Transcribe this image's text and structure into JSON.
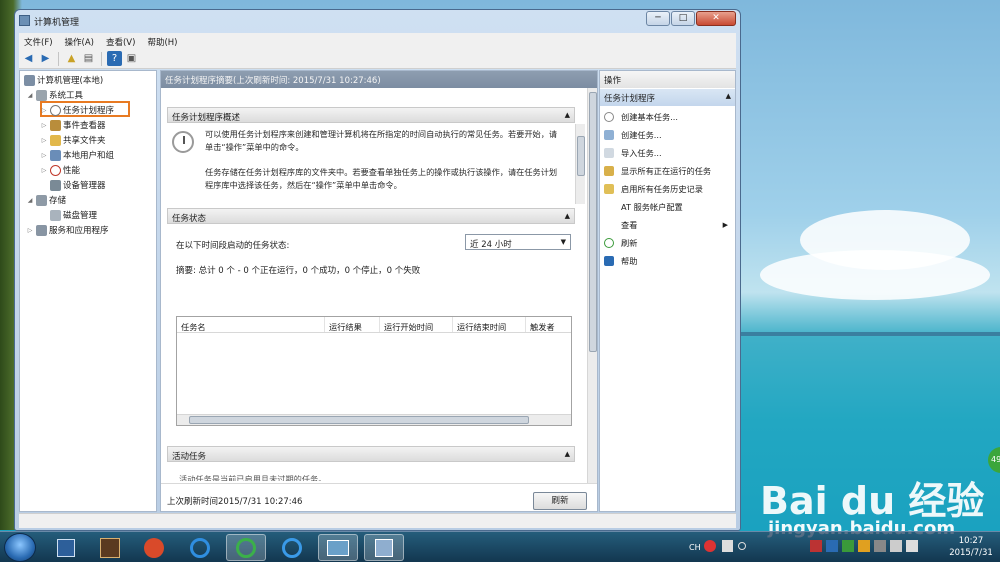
{
  "window": {
    "title": "计算机管理",
    "controls": [
      "─",
      "□",
      "✕"
    ]
  },
  "menu": [
    "文件(F)",
    "操作(A)",
    "查看(V)",
    "帮助(H)"
  ],
  "tree": {
    "root": "计算机管理(本地)",
    "system_tools": "系统工具",
    "task_scheduler": "任务计划程序",
    "event_viewer": "事件查看器",
    "shared_folders": "共享文件夹",
    "local_users": "本地用户和组",
    "performance": "性能",
    "device_manager": "设备管理器",
    "storage": "存储",
    "disk_management": "磁盘管理",
    "services": "服务和应用程序"
  },
  "center": {
    "header": "任务计划程序摘要(上次刷新时间: 2015/7/31 10:27:46)",
    "overview_title": "任务计划程序概述",
    "overview_p1": "可以使用任务计划程序来创建和管理计算机将在所指定的时间自动执行的常见任务。若要开始，请单击“操作”菜单中的命令。",
    "overview_p2": "任务存储在任务计划程序库的文件夹中。若要查看单独任务上的操作或执行该操作，请在任务计划程序库中选择该任务，然后在“操作”菜单中单击命令。",
    "status_title": "任务状态",
    "status_label": "在以下时间段启动的任务状态:",
    "period": "近 24 小时",
    "summary": "摘要: 总计 0 个 - 0 个正在运行，0 个成功，0 个停止，0 个失败",
    "columns": [
      "任务名",
      "运行结果",
      "运行开始时间",
      "运行结束时间",
      "触发者"
    ],
    "active_title": "活动任务",
    "active_partial": "活动任务是当前已启用且未过期的任务。",
    "last_refresh": "上次刷新时间2015/7/31 10:27:46",
    "refresh_button": "刷新"
  },
  "actions": {
    "title": "操作",
    "group": "任务计划程序",
    "items": [
      "创建基本任务...",
      "创建任务...",
      "导入任务...",
      "显示所有正在运行的任务",
      "启用所有任务历史记录",
      "AT 服务帐户配置",
      "查看",
      "刷新",
      "帮助"
    ]
  },
  "taskbar": {
    "lang": "CH",
    "time": "10:27",
    "date": "2015/7/31"
  },
  "desktop": {
    "watermark": "Bai du 经验",
    "watermark_url": "jingyan.baidu.com",
    "badge": "49"
  }
}
